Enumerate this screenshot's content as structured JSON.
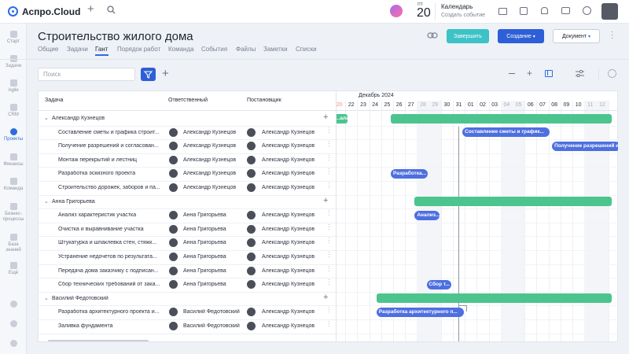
{
  "app": {
    "brand": "Аспро.Cloud"
  },
  "topbar": {
    "date_weekday": "пт",
    "date_day": "20",
    "calendar_title": "Календарь",
    "calendar_sub": "Создать событие"
  },
  "sidebar": {
    "items": [
      {
        "label": "Старт",
        "active": false
      },
      {
        "label": "Задачи",
        "active": false
      },
      {
        "label": "Agile",
        "active": false
      },
      {
        "label": "CRM",
        "active": false
      },
      {
        "label": "Проекты",
        "active": true
      },
      {
        "label": "Финансы",
        "active": false
      },
      {
        "label": "Команда",
        "active": false
      },
      {
        "label": "Бизнес-процессы",
        "active": false
      },
      {
        "label": "База знаний",
        "active": false
      },
      {
        "label": "Ещё",
        "active": false
      }
    ]
  },
  "page": {
    "title": "Строительство жилого дома",
    "tabs": [
      "Общие",
      "Задачи",
      "Гант",
      "Порядок работ",
      "Команда",
      "События",
      "Файлы",
      "Заметки",
      "Списки"
    ],
    "active_tab": "Гант",
    "finish_label": "Завершить",
    "create_label": "Создание",
    "document_label": "Документ"
  },
  "filter": {
    "search_placeholder": "Поиск"
  },
  "table": {
    "headers": {
      "task": "Задача",
      "responsible": "Ответственный",
      "assigner": "Постановщик"
    },
    "groups": [
      {
        "name": "Александр Кузнецов",
        "rows": [
          {
            "task": "Составление сметы и графика строит...",
            "responsible": "Александр Кузнецов",
            "assigner": "Александр Кузнецов"
          },
          {
            "task": "Получение разрешений и согласован...",
            "responsible": "Александр Кузнецов",
            "assigner": "Александр Кузнецов"
          },
          {
            "task": "Монтаж перекрытий и лестниц",
            "responsible": "Александр Кузнецов",
            "assigner": "Александр Кузнецов"
          },
          {
            "task": "Разработка эскизного проекта",
            "responsible": "Александр Кузнецов",
            "assigner": "Александр Кузнецов"
          },
          {
            "task": "Строительство дорожек, заборов и па...",
            "responsible": "Александр Кузнецов",
            "assigner": "Александр Кузнецов"
          }
        ]
      },
      {
        "name": "Анна Григорьева",
        "rows": [
          {
            "task": "Анализ характеристик участка",
            "responsible": "Анна Григорьева",
            "assigner": "Александр Кузнецов"
          },
          {
            "task": "Очистка и выравнивание участка",
            "responsible": "Анна Григорьева",
            "assigner": "Александр Кузнецов"
          },
          {
            "task": "Штукатурка и шпаклевка стен, стяжк...",
            "responsible": "Анна Григорьева",
            "assigner": "Александр Кузнецов"
          },
          {
            "task": "Устранение недочетов по результата...",
            "responsible": "Анна Григорьева",
            "assigner": "Александр Кузнецов"
          },
          {
            "task": "Передача дома заказчику с подписан...",
            "responsible": "Анна Григорьева",
            "assigner": "Александр Кузнецов"
          },
          {
            "task": "Сбор технических требований от зака...",
            "responsible": "Анна Григорьева",
            "assigner": "Александр Кузнецов"
          }
        ]
      },
      {
        "name": "Василий Федотовский",
        "rows": [
          {
            "task": "Разработка архитектурного проекта и...",
            "responsible": "Василий Федотовский",
            "assigner": "Александр Кузнецов"
          },
          {
            "task": "Заливка фундамента",
            "responsible": "Василий Федотовский",
            "assigner": "Александр Кузнецов"
          }
        ]
      }
    ]
  },
  "gantt": {
    "month": "Декабрь 2024",
    "days": [
      "20",
      "22",
      "23",
      "24",
      "25",
      "26",
      "27",
      "28",
      "29",
      "30",
      "31",
      "01",
      "02",
      "03",
      "04",
      "05",
      "06",
      "07",
      "08",
      "09",
      "10",
      "11",
      "12"
    ],
    "weekend_days": [
      "28",
      "29",
      "04",
      "05",
      "11",
      "12"
    ],
    "today": "20",
    "bars": [
      {
        "label": "...ала"
      },
      {
        "label": ""
      },
      {
        "label": "Составление сметы и график..."
      },
      {
        "label": "Получение разрешений и с..."
      },
      {
        "label": "Разработка..."
      },
      {
        "label": ""
      },
      {
        "label": "Анализ..."
      },
      {
        "label": "Сбор т..."
      },
      {
        "label": ""
      },
      {
        "label": "Разработка архитектурного п..."
      }
    ]
  },
  "colors": {
    "accent": "#2d6cdf",
    "group_bar": "#4cc48e",
    "task_bar": "#4e6fdf",
    "finish_button": "#3cc2c7"
  }
}
